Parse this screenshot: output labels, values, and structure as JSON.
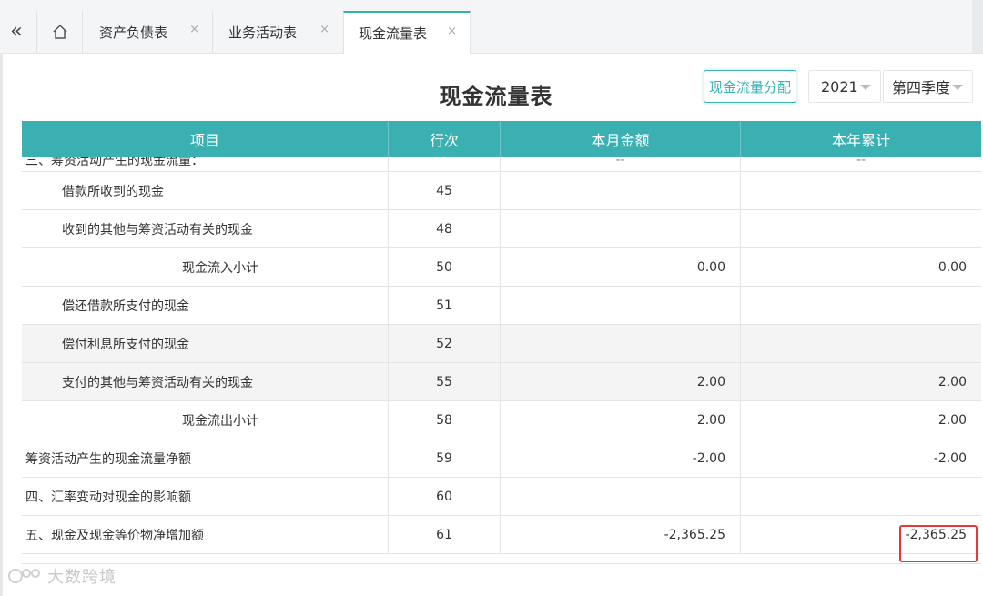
{
  "tabs": {
    "collapse_glyph": "«",
    "items": [
      {
        "label": "资产负债表"
      },
      {
        "label": "业务活动表"
      },
      {
        "label": "现金流量表"
      }
    ],
    "close_glyph": "×"
  },
  "header": {
    "title": "现金流量表",
    "distribute_button": "现金流量分配",
    "year": "2021",
    "quarter": "第四季度"
  },
  "table": {
    "columns": [
      "项目",
      "行次",
      "本月金额",
      "本年累计"
    ],
    "rows": [
      {
        "name": "三、筹资活动产生的现金流量：",
        "line": "",
        "month": "--",
        "year": "--",
        "indent": 0,
        "shaded": false,
        "partial": true
      },
      {
        "name": "借款所收到的现金",
        "line": "45",
        "month": "",
        "year": "",
        "indent": 1,
        "shaded": false
      },
      {
        "name": "收到的其他与筹资活动有关的现金",
        "line": "48",
        "month": "",
        "year": "",
        "indent": 1,
        "shaded": false
      },
      {
        "name": "现金流入小计",
        "line": "50",
        "month": "0.00",
        "year": "0.00",
        "indent": 2,
        "shaded": false
      },
      {
        "name": "偿还借款所支付的现金",
        "line": "51",
        "month": "",
        "year": "",
        "indent": 1,
        "shaded": false
      },
      {
        "name": "偿付利息所支付的现金",
        "line": "52",
        "month": "",
        "year": "",
        "indent": 1,
        "shaded": true
      },
      {
        "name": "支付的其他与筹资活动有关的现金",
        "line": "55",
        "month": "2.00",
        "year": "2.00",
        "indent": 1,
        "shaded": true
      },
      {
        "name": "现金流出小计",
        "line": "58",
        "month": "2.00",
        "year": "2.00",
        "indent": 2,
        "shaded": false
      },
      {
        "name": "筹资活动产生的现金流量净额",
        "line": "59",
        "month": "-2.00",
        "year": "-2.00",
        "indent": 0,
        "shaded": false
      },
      {
        "name": "四、汇率变动对现金的影响额",
        "line": "60",
        "month": "",
        "year": "",
        "indent": 0,
        "shaded": false
      },
      {
        "name": "五、现金及现金等价物净增加额",
        "line": "61",
        "month": "-2,365.25",
        "year": "-2,365.25",
        "indent": 0,
        "shaded": false
      }
    ]
  },
  "watermark": {
    "text": "大数跨境"
  },
  "colors": {
    "accent": "#3ab0b3",
    "highlight": "#e53935"
  }
}
